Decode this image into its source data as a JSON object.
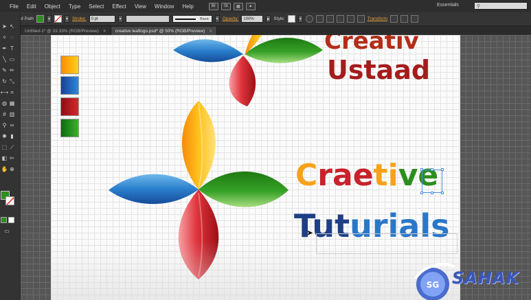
{
  "menu": [
    "File",
    "Edit",
    "Object",
    "Type",
    "Select",
    "Effect",
    "View",
    "Window",
    "Help"
  ],
  "workspace": "Essentials",
  "control_bar": {
    "object_type": "Compound Path",
    "stroke_label": "Stroke:",
    "stroke_value": "0 pt",
    "brush_label": "Basic",
    "opacity_label": "Opacity:",
    "opacity_value": "100%",
    "style_label": "Style:",
    "transform_label": "Transform"
  },
  "tabs": [
    {
      "label": "Untitled-1* @ 33.33% (RGB/Preview)"
    },
    {
      "label": "creative leaflogo.psd* @ 50% (RGB/Preview)"
    }
  ],
  "artwork": {
    "top_logo": {
      "line1": "Creativ",
      "line2": "Ustaad"
    },
    "main_logo": {
      "line1": "Craetive",
      "line2": "Tuturials"
    }
  },
  "watermark": {
    "text": "SAHAK",
    "badge": "SG"
  },
  "colors": {
    "orange": "#f7a21b",
    "blue": "#2a77c8",
    "red": "#c8222b",
    "green": "#2d8e1e",
    "navy": "#1e3f86"
  }
}
